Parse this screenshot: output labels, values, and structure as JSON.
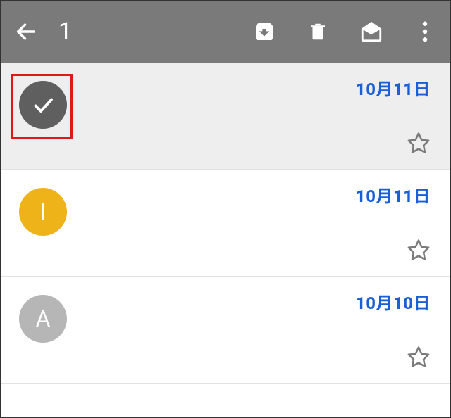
{
  "toolbar": {
    "selected_count": "1"
  },
  "rows": [
    {
      "avatar_letter": "",
      "date": "10月11日",
      "selected": true,
      "avatar_color": "check"
    },
    {
      "avatar_letter": "I",
      "date": "10月11日",
      "selected": false,
      "avatar_color": "yellow"
    },
    {
      "avatar_letter": "A",
      "date": "10月10日",
      "selected": false,
      "avatar_color": "grey"
    }
  ],
  "colors": {
    "highlight": "#e01818",
    "date": "#1a5fd6"
  }
}
